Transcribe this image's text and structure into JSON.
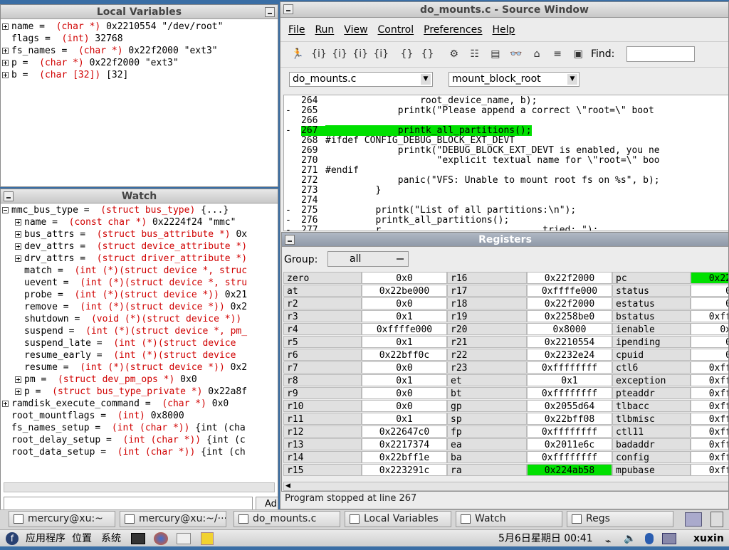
{
  "local_vars": {
    "title": "Local Variables",
    "items": [
      {
        "name": "name",
        "type": "(char *)",
        "value": "0x2210554 \"/dev/root\"",
        "expand": "plus"
      },
      {
        "name": "flags",
        "type": "(int)",
        "value": "32768",
        "expand": ""
      },
      {
        "name": "fs_names",
        "type": "(char *)",
        "value": "0x22f2000 \"ext3\"",
        "expand": "plus"
      },
      {
        "name": "p",
        "type": "(char *)",
        "value": "0x22f2000 \"ext3\"",
        "expand": "plus"
      },
      {
        "name": "b",
        "type": "(char [32])",
        "value": "[32]",
        "expand": "plus"
      }
    ]
  },
  "watch": {
    "title": "Watch",
    "items": [
      {
        "indent": 0,
        "expand": "minus",
        "name": "mmc_bus_type",
        "type": "(struct bus_type)",
        "value": "{...}"
      },
      {
        "indent": 1,
        "expand": "plus",
        "name": "name",
        "type": "(const char *)",
        "value": "0x2224f24 \"mmc\""
      },
      {
        "indent": 1,
        "expand": "plus",
        "name": "bus_attrs",
        "type": "(struct bus_attribute *)",
        "value": "0x"
      },
      {
        "indent": 1,
        "expand": "plus",
        "name": "dev_attrs",
        "type": "(struct device_attribute *)",
        "value": ""
      },
      {
        "indent": 1,
        "expand": "plus",
        "name": "drv_attrs",
        "type": "(struct driver_attribute *)",
        "value": ""
      },
      {
        "indent": 1,
        "expand": "",
        "name": "match",
        "type": "(int (*)(struct device *, struc",
        "value": ""
      },
      {
        "indent": 1,
        "expand": "",
        "name": "uevent",
        "type": "(int (*)(struct device *, stru",
        "value": ""
      },
      {
        "indent": 1,
        "expand": "",
        "name": "probe",
        "type": "(int (*)(struct device *))",
        "value": "0x21"
      },
      {
        "indent": 1,
        "expand": "",
        "name": "remove",
        "type": "(int (*)(struct device *))",
        "value": "0x2"
      },
      {
        "indent": 1,
        "expand": "",
        "name": "shutdown",
        "type": "(void (*)(struct device *))",
        "value": ""
      },
      {
        "indent": 1,
        "expand": "",
        "name": "suspend",
        "type": "(int (*)(struct device *, pm_",
        "value": ""
      },
      {
        "indent": 1,
        "expand": "",
        "name": "suspend_late",
        "type": "(int (*)(struct device",
        "value": ""
      },
      {
        "indent": 1,
        "expand": "",
        "name": "resume_early",
        "type": "(int (*)(struct device",
        "value": ""
      },
      {
        "indent": 1,
        "expand": "",
        "name": "resume",
        "type": "(int (*)(struct device *))",
        "value": "0x2"
      },
      {
        "indent": 1,
        "expand": "plus",
        "name": "pm",
        "type": "(struct dev_pm_ops *)",
        "value": "0x0"
      },
      {
        "indent": 1,
        "expand": "plus",
        "name": "p",
        "type": "(struct bus_type_private *)",
        "value": "0x22a8f"
      },
      {
        "indent": 0,
        "expand": "plus",
        "name": "ramdisk_execute_command",
        "type": "(char *)",
        "value": "0x0"
      },
      {
        "indent": 0,
        "expand": "",
        "name": "root_mountflags",
        "type": "(int)",
        "value": "0x8000"
      },
      {
        "indent": 0,
        "expand": "",
        "name": "fs_names_setup",
        "type": "(int (char *))",
        "value": "{int (cha"
      },
      {
        "indent": 0,
        "expand": "",
        "name": "root_delay_setup",
        "type": "(int (char *))",
        "value": "{int (c"
      },
      {
        "indent": 0,
        "expand": "",
        "name": "root_data_setup",
        "type": "(int (char *))",
        "value": "{int (ch"
      }
    ],
    "add_label": "Ad"
  },
  "source": {
    "title": "do_mounts.c - Source Window",
    "menu": [
      "File",
      "Run",
      "View",
      "Control",
      "Preferences",
      "Help"
    ],
    "find_label": "Find:",
    "file_select": "do_mounts.c",
    "func_select": "mount_block_root",
    "lines": [
      {
        "bp": "",
        "num": "264",
        "text": "                 root_device_name, b);",
        "hl": false
      },
      {
        "bp": "-",
        "num": "265",
        "text": "             printk(\"Please append a correct \\\"root=\\\" boot",
        "hl": false
      },
      {
        "bp": "",
        "num": "266",
        "text": "",
        "hl": false
      },
      {
        "bp": "-",
        "num": "267",
        "text": "             printk_all_partitions();",
        "hl": true
      },
      {
        "bp": "",
        "num": "268",
        "text": "#ifdef CONFIG_DEBUG_BLOCK_EXT_DEVT",
        "hl": false
      },
      {
        "bp": "",
        "num": "269",
        "text": "             printk(\"DEBUG_BLOCK_EXT_DEVT is enabled, you ne",
        "hl": false
      },
      {
        "bp": "",
        "num": "270",
        "text": "                    \"explicit textual name for \\\"root=\\\" boo",
        "hl": false
      },
      {
        "bp": "",
        "num": "271",
        "text": "#endif",
        "hl": false
      },
      {
        "bp": "",
        "num": "272",
        "text": "             panic(\"VFS: Unable to mount root fs on %s\", b);",
        "hl": false
      },
      {
        "bp": "",
        "num": "273",
        "text": "         }",
        "hl": false
      },
      {
        "bp": "",
        "num": "274",
        "text": "",
        "hl": false
      },
      {
        "bp": "-",
        "num": "275",
        "text": "         printk(\"List of all partitions:\\n\");",
        "hl": false
      },
      {
        "bp": "-",
        "num": "276",
        "text": "         printk_all_partitions();",
        "hl": false
      },
      {
        "bp": "-",
        "num": "277",
        "text": "         r                             tried: \");",
        "hl": false
      }
    ],
    "status": "Program stopped at line 267"
  },
  "registers": {
    "title": "Registers",
    "group_label": "Group:",
    "group_value": "all",
    "col1": [
      [
        "zero",
        "0x0"
      ],
      [
        "at",
        "0x22be000"
      ],
      [
        "r2",
        "0x0"
      ],
      [
        "r3",
        "0x1"
      ],
      [
        "r4",
        "0xffffe000"
      ],
      [
        "r5",
        "0x1"
      ],
      [
        "r6",
        "0x22bff0c"
      ],
      [
        "r7",
        "0x0"
      ],
      [
        "r8",
        "0x1"
      ],
      [
        "r9",
        "0x0"
      ],
      [
        "r10",
        "0x0"
      ],
      [
        "r11",
        "0x1"
      ],
      [
        "r12",
        "0x22647c0"
      ],
      [
        "r13",
        "0x2217374"
      ],
      [
        "r14",
        "0x22bff1e"
      ],
      [
        "r15",
        "0x223291c"
      ]
    ],
    "col2": [
      [
        "r16",
        "0x22f2000"
      ],
      [
        "r17",
        "0xffffe000"
      ],
      [
        "r18",
        "0x22f2000"
      ],
      [
        "r19",
        "0x2258be0"
      ],
      [
        "r20",
        "0x8000"
      ],
      [
        "r21",
        "0x2210554"
      ],
      [
        "r22",
        "0x2232e24"
      ],
      [
        "r23",
        "0xffffffff"
      ],
      [
        "et",
        "0x1"
      ],
      [
        "bt",
        "0xffffffff"
      ],
      [
        "gp",
        "0x2055d64"
      ],
      [
        "sp",
        "0x22bff08"
      ],
      [
        "fp",
        "0xffffffff"
      ],
      [
        "ea",
        "0x2011e6c"
      ],
      [
        "ba",
        "0xffffffff"
      ],
      [
        "ra",
        "0x224ab58"
      ]
    ],
    "col3": [
      [
        "pc",
        "0x22"
      ],
      [
        "status",
        "0"
      ],
      [
        "estatus",
        "0"
      ],
      [
        "bstatus",
        "0xff"
      ],
      [
        "ienable",
        "0x"
      ],
      [
        "ipending",
        "0"
      ],
      [
        "cpuid",
        "0"
      ],
      [
        "ctl6",
        "0xff"
      ],
      [
        "exception",
        "0xff"
      ],
      [
        "pteaddr",
        "0xff"
      ],
      [
        "tlbacc",
        "0xff"
      ],
      [
        "tlbmisc",
        "0xff"
      ],
      [
        "ctl11",
        "0xff"
      ],
      [
        "badaddr",
        "0xff"
      ],
      [
        "config",
        "0xff"
      ],
      [
        "mpubase",
        "0xff"
      ]
    ]
  },
  "taskbar": {
    "buttons": [
      "mercury@xu:~",
      "mercury@xu:~/···",
      "do_mounts.c",
      "Local Variables",
      "Watch",
      "Regs"
    ]
  },
  "panel": {
    "menus": [
      "应用程序",
      "位置",
      "系统"
    ],
    "clock": "5月6日星期日 00:41",
    "user": "xuxin"
  },
  "colors": {
    "highlight": "#00e000",
    "type_red": "#d00000"
  }
}
